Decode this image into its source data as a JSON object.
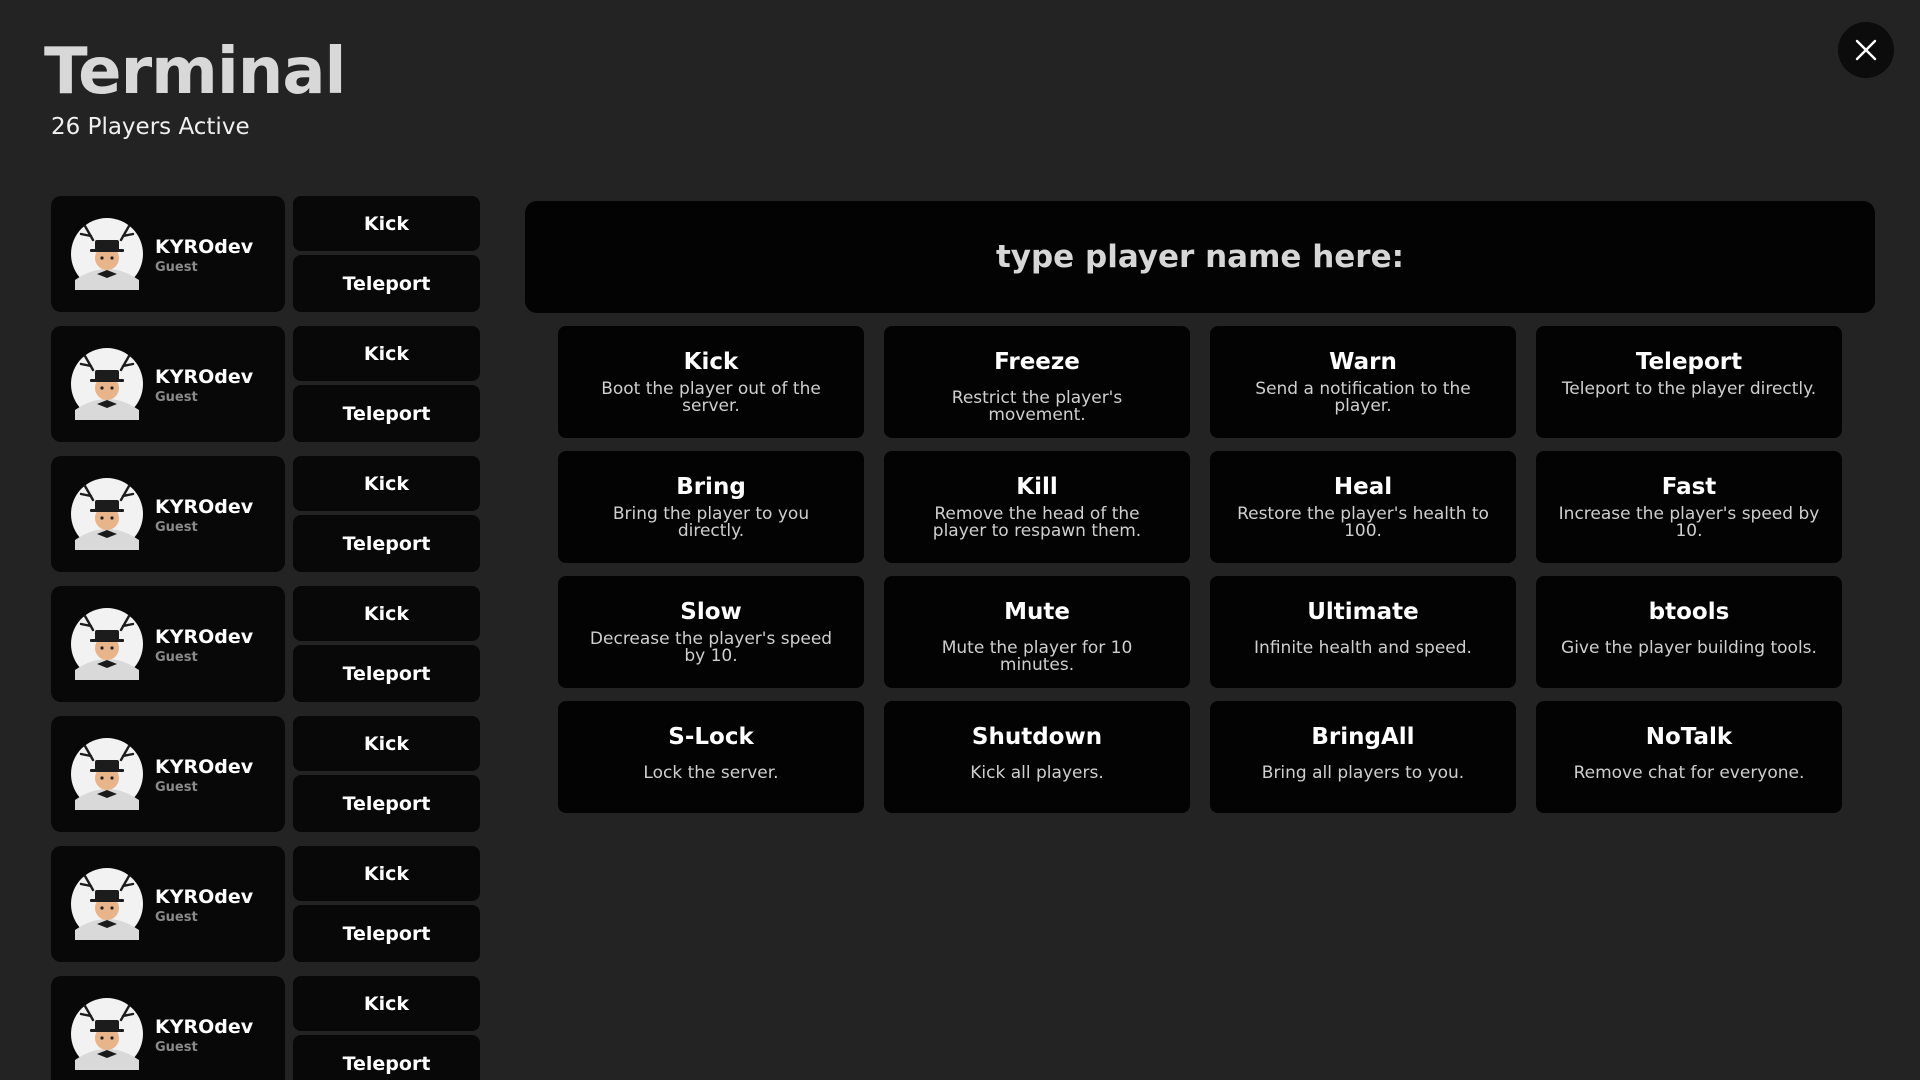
{
  "header": {
    "title": "Terminal",
    "subtitle": "26 Players Active"
  },
  "icons": {
    "close": "close-icon",
    "avatar": "avatar-icon"
  },
  "players": [
    {
      "name": "KYROdev",
      "role": "Guest",
      "kick_label": "Kick",
      "teleport_label": "Teleport"
    },
    {
      "name": "KYROdev",
      "role": "Guest",
      "kick_label": "Kick",
      "teleport_label": "Teleport"
    },
    {
      "name": "KYROdev",
      "role": "Guest",
      "kick_label": "Kick",
      "teleport_label": "Teleport"
    },
    {
      "name": "KYROdev",
      "role": "Guest",
      "kick_label": "Kick",
      "teleport_label": "Teleport"
    },
    {
      "name": "KYROdev",
      "role": "Guest",
      "kick_label": "Kick",
      "teleport_label": "Teleport"
    },
    {
      "name": "KYROdev",
      "role": "Guest",
      "kick_label": "Kick",
      "teleport_label": "Teleport"
    },
    {
      "name": "KYROdev",
      "role": "Guest",
      "kick_label": "Kick",
      "teleport_label": "Teleport"
    }
  ],
  "search": {
    "placeholder": "type player name here:",
    "value": ""
  },
  "commands": [
    {
      "title": "Kick",
      "desc": "Boot the player out of the server."
    },
    {
      "title": "Freeze",
      "desc": "Restrict the player's movement."
    },
    {
      "title": "Warn",
      "desc": "Send a notification to the player."
    },
    {
      "title": "Teleport",
      "desc": "Teleport to the player directly."
    },
    {
      "title": "Bring",
      "desc": "Bring the player to you directly."
    },
    {
      "title": "Kill",
      "desc": "Remove the head of the player to respawn them."
    },
    {
      "title": "Heal",
      "desc": "Restore the player's health to 100."
    },
    {
      "title": "Fast",
      "desc": "Increase the player's speed by 10."
    },
    {
      "title": "Slow",
      "desc": "Decrease the player's speed by 10."
    },
    {
      "title": "Mute",
      "desc": "Mute the player for 10 minutes."
    },
    {
      "title": "Ultimate",
      "desc": "Infinite health and speed."
    },
    {
      "title": "btools",
      "desc": "Give the player building tools."
    },
    {
      "title": "S-Lock",
      "desc": "Lock the server."
    },
    {
      "title": "Shutdown",
      "desc": "Kick all players."
    },
    {
      "title": "BringAll",
      "desc": "Bring all players to you."
    },
    {
      "title": "NoTalk",
      "desc": "Remove chat for everyone."
    }
  ]
}
